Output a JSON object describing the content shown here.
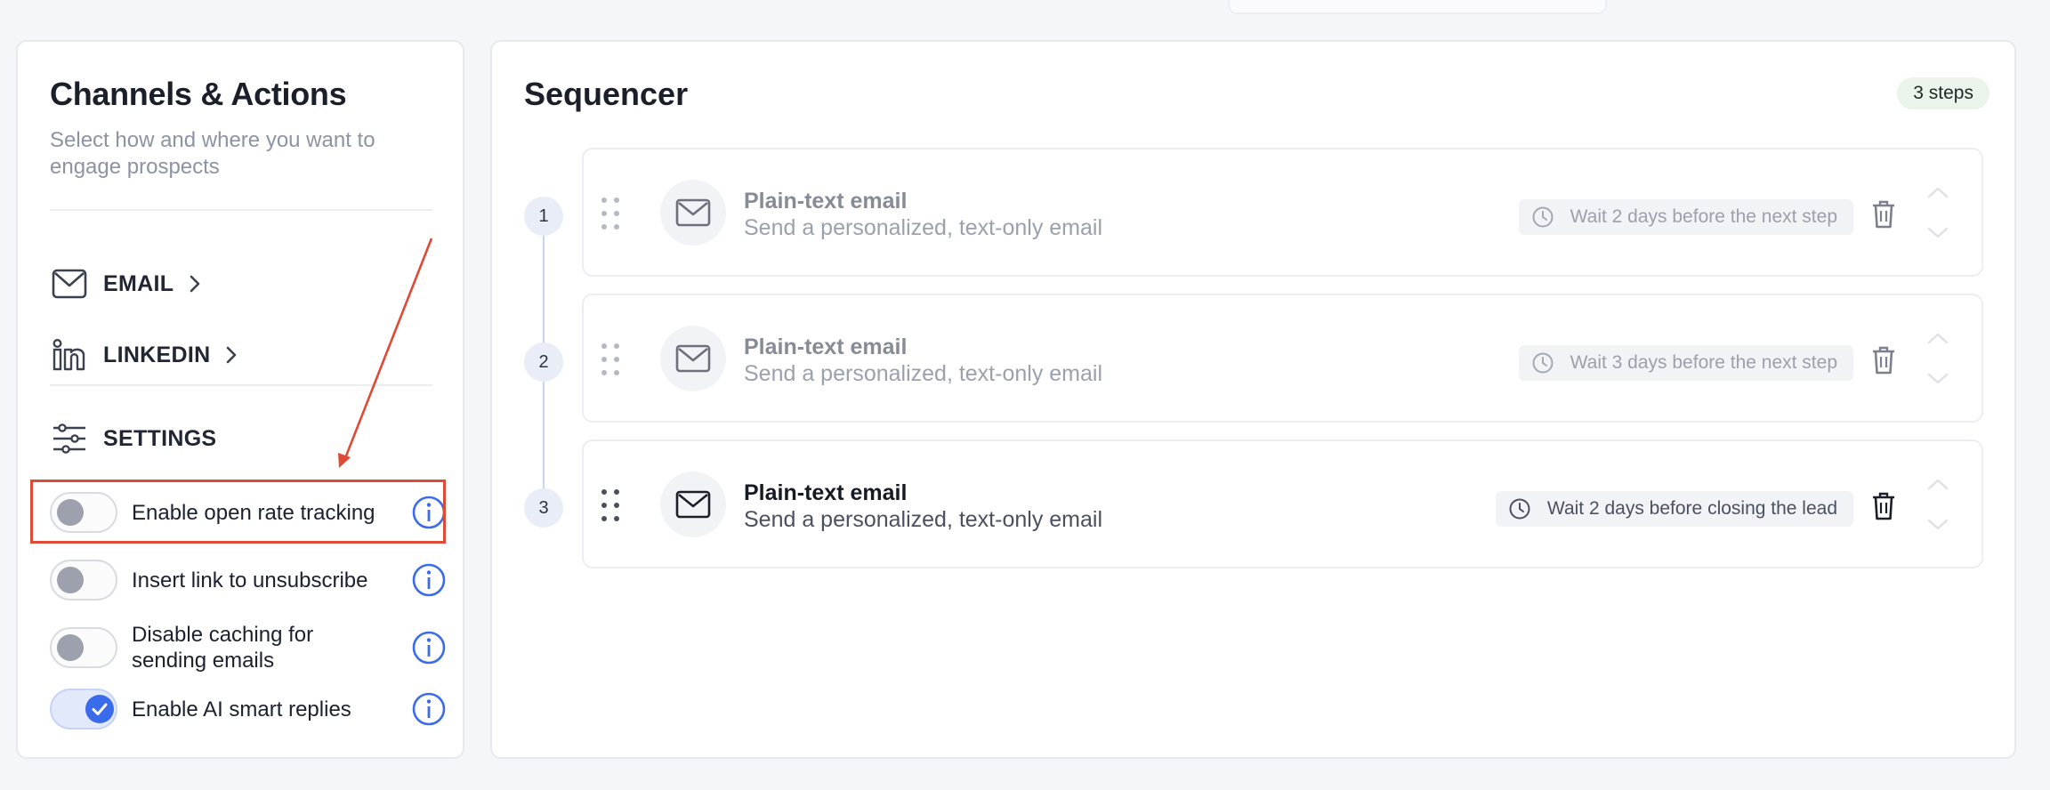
{
  "left_panel": {
    "title": "Channels & Actions",
    "subtitle": "Select how and where you want to engage prospects",
    "channels": [
      {
        "label": "EMAIL",
        "icon": "mail-icon"
      },
      {
        "label": "LINKEDIN",
        "icon": "linkedin-icon"
      }
    ],
    "settings_label": "SETTINGS",
    "toggles": [
      {
        "label": "Enable open rate tracking",
        "on": false
      },
      {
        "label": "Insert link to unsubscribe",
        "on": false
      },
      {
        "label": "Disable caching for sending emails",
        "on": false
      },
      {
        "label": "Enable AI smart replies",
        "on": true
      }
    ]
  },
  "sequencer": {
    "title": "Sequencer",
    "badge": "3 steps",
    "steps": [
      {
        "number": "1",
        "title": "Plain-text email",
        "description": "Send a personalized, text-only email",
        "wait": "Wait 2 days before the next step",
        "active": false
      },
      {
        "number": "2",
        "title": "Plain-text email",
        "description": "Send a personalized, text-only email",
        "wait": "Wait 3 days before the next step",
        "active": false
      },
      {
        "number": "3",
        "title": "Plain-text email",
        "description": "Send a personalized, text-only email",
        "wait": "Wait 2 days before closing the lead",
        "active": true
      }
    ]
  },
  "colors": {
    "accent": "#3a6bea",
    "annotation": "#df4a36",
    "badge_bg": "#eaf4ea"
  }
}
